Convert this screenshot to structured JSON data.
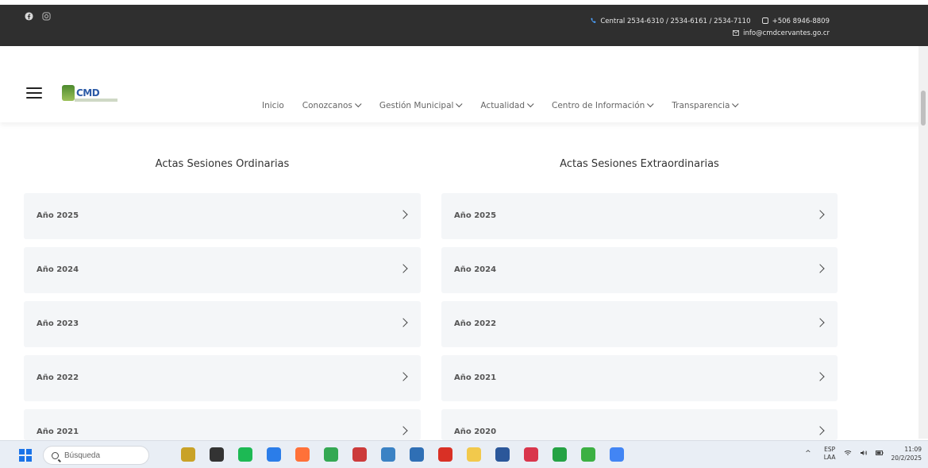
{
  "topbar": {
    "social_icons": [
      "facebook-icon",
      "instagram-icon"
    ],
    "phone_line": "Central 2534-6310 / 2534-6161 / 2534-7110",
    "whatsapp_line": "+506 8946-8809",
    "email_line": "info@cmdcervantes.go.cr"
  },
  "header": {
    "logo_text": "CMD",
    "nav": [
      {
        "label": "Inicio",
        "dropdown": false
      },
      {
        "label": "Conozcanos",
        "dropdown": true
      },
      {
        "label": "Gestión Municipal",
        "dropdown": true
      },
      {
        "label": "Actualidad",
        "dropdown": true
      },
      {
        "label": "Centro de Información",
        "dropdown": true
      },
      {
        "label": "Transparencia",
        "dropdown": true
      }
    ]
  },
  "main": {
    "left": {
      "title": "Actas Sesiones Ordinarias",
      "items": [
        "Año 2025",
        "Año 2024",
        "Año 2023",
        "Año 2022",
        "Año 2021"
      ]
    },
    "right": {
      "title": "Actas Sesiones Extraordinarias",
      "items": [
        "Año 2025",
        "Año 2024",
        "Año 2022",
        "Año 2021",
        "Año 2020"
      ]
    }
  },
  "taskbar": {
    "search_placeholder": "Búsqueda",
    "language": "ESP",
    "language_sub": "LAA",
    "time": "11:09",
    "date": "20/2/2025",
    "app_colors": [
      "#c9a227",
      "#333333",
      "#1db954",
      "#2b7de9",
      "#ff7139",
      "#34a853",
      "#cc3b3b",
      "#3b82c4",
      "#2f6fb5",
      "#d93025",
      "#f2c94c",
      "#2b579a",
      "#d9364c",
      "#25a244",
      "#3cb043",
      "#4285f4"
    ]
  },
  "colors": {
    "topbar_bg": "#2f2f2f",
    "card_bg": "#f4f6f8",
    "taskbar_bg": "#e9eef5"
  }
}
